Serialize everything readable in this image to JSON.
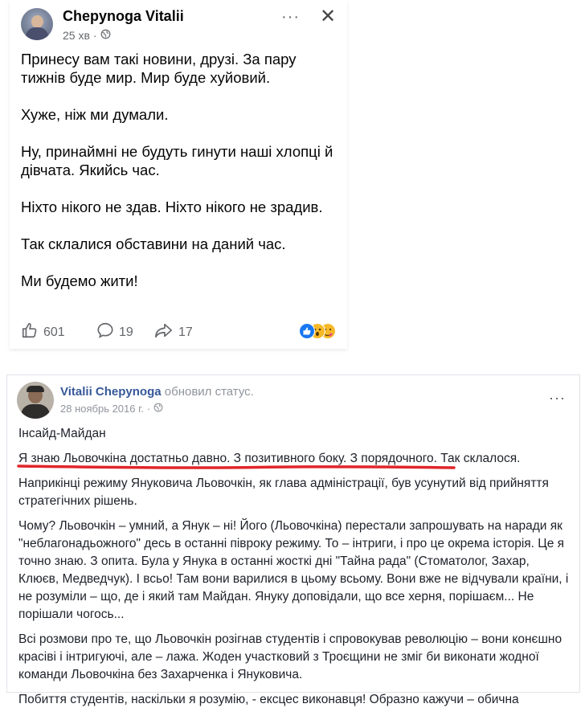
{
  "post1": {
    "author": "Chepynoga Vitalii",
    "time": "25 хв",
    "separator": "·",
    "more_label": "···",
    "close_label": "✕",
    "paragraphs": [
      "Принесу вам такі новини, друзі. За пару тижнів буде мир. Мир буде хуйовий.",
      "Хуже, ніж ми думали.",
      "Ну, принаймні не будуть гинути наші хлопці й дівчата. Якийсь час.",
      "Ніхто нікого не здав. Ніхто нікого не зрадив.",
      "Так склалися обставини на даний час.",
      "Ми будемо жити!"
    ],
    "likes": "601",
    "comments": "19",
    "shares": "17",
    "reaction_icons": [
      "like-icon",
      "wow-icon",
      "care-icon"
    ]
  },
  "post2": {
    "author": "Vitalii Chepynoga",
    "action": "обновил статус.",
    "date": "28 ноябрь 2016 г.",
    "separator": "·",
    "more_label": "···",
    "paragraphs": [
      "Інсайд-Майдан",
      "Я знаю Льовочкіна достатньо давно. З позитивного боку. З порядочного. Так склалося.",
      "Наприкінці режиму Януковича Льовочкін, як глава адміністрації, був усунутий від прийняття стратегічних рішень.",
      "Чому? Льовочкін – умний, а Янук – ні! Його (Льовочкіна) перестали запрошувать на наради як \"неблагонадьожного\" десь в останні півроку режиму. То – інтриги, і про це окрема історія. Це я точно знаю. З опита.  Була у Янука в останні жосткі дні \"Тайна рада\" (Стоматолог, Захар, Клюєв, Медведчук). І всьо! Там вони варилися в цьому всьому. Вони вже не відчували країни, і не розуміли – що, де і який там Майдан. Януку доповідали, що все херня, порішаєм... Не порішали чогось...",
      "Всі розмови про те, що Льовочкін розігнав студентів і спровокував революцію – вони конєшно красіві і інтригуючі, але – лажа. Жоден участковий з Троєщини не зміг би виконати жодної команди Льовочкіна без Захарченка і Януковича.",
      "Побиття студентів, наскільки я розумію, - ексцес виконавця! Образно кажучи – обична"
    ],
    "underline_color": "#e0262b"
  }
}
